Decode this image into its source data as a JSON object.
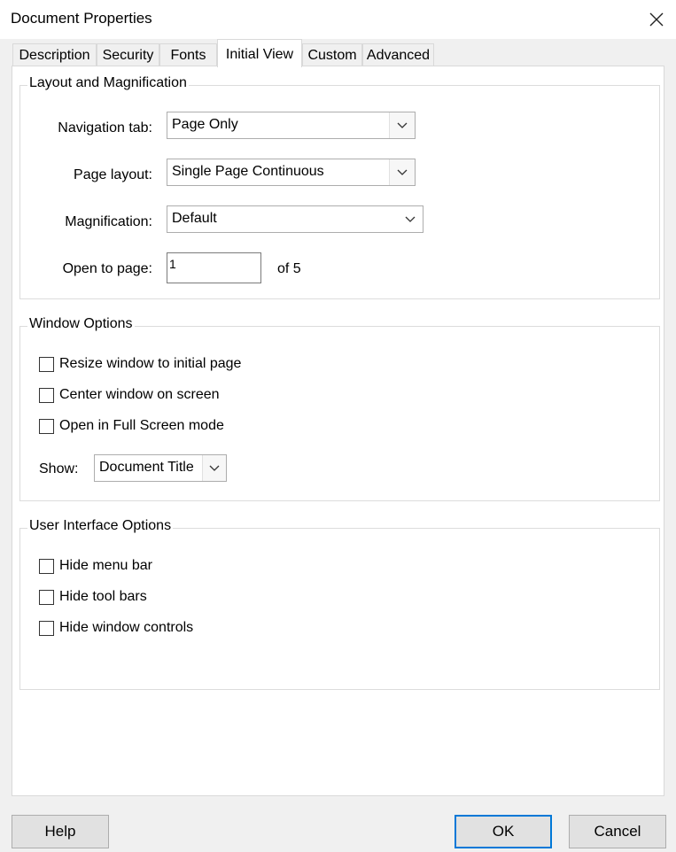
{
  "window": {
    "title": "Document Properties"
  },
  "tabs": [
    {
      "label": "Description"
    },
    {
      "label": "Security"
    },
    {
      "label": "Fonts"
    },
    {
      "label": "Initial View"
    },
    {
      "label": "Custom"
    },
    {
      "label": "Advanced"
    }
  ],
  "active_tab": "Initial View",
  "layout_group": {
    "title": "Layout and Magnification",
    "navigation_tab_label": "Navigation tab:",
    "navigation_tab_value": "Page Only",
    "page_layout_label": "Page layout:",
    "page_layout_value": "Single Page Continuous",
    "magnification_label": "Magnification:",
    "magnification_value": "Default",
    "open_to_page_label": "Open to page:",
    "open_to_page_value": "1",
    "of_pages": "of 5"
  },
  "window_group": {
    "title": "Window Options",
    "options": [
      {
        "label": "Resize window to initial page",
        "checked": false
      },
      {
        "label": "Center window on screen",
        "checked": false
      },
      {
        "label": "Open in Full Screen mode",
        "checked": false
      }
    ],
    "show_label": "Show:",
    "show_value": "Document Title"
  },
  "ui_group": {
    "title": "User Interface Options",
    "options": [
      {
        "label": "Hide menu bar",
        "checked": false
      },
      {
        "label": "Hide tool bars",
        "checked": false
      },
      {
        "label": "Hide window controls",
        "checked": false
      }
    ]
  },
  "buttons": {
    "help": "Help",
    "ok": "OK",
    "cancel": "Cancel"
  }
}
